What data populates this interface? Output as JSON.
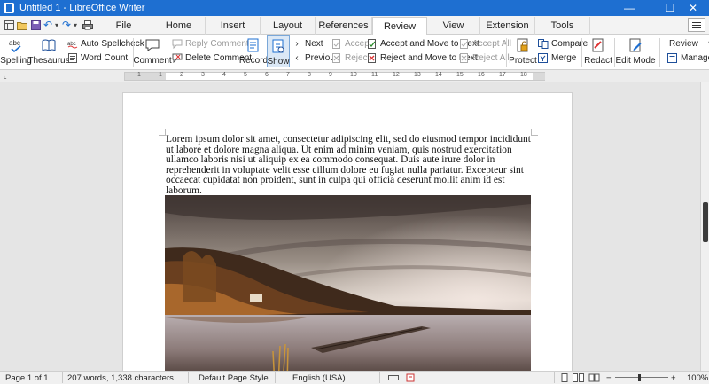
{
  "window": {
    "title": "Untitled 1 - LibreOffice Writer",
    "controls": {
      "minimize": "—",
      "maximize": "☐",
      "close": "✕"
    }
  },
  "quick_access": [
    {
      "icon": "menu-grid-icon"
    },
    {
      "icon": "open-folder-icon"
    },
    {
      "icon": "save-icon"
    },
    {
      "icon": "undo-icon",
      "glyph": "↶"
    },
    {
      "icon": "dropdown-icon",
      "glyph": "▾"
    },
    {
      "icon": "redo-icon",
      "glyph": "↷"
    },
    {
      "icon": "dropdown-icon",
      "glyph": "▾"
    },
    {
      "icon": "print-icon"
    }
  ],
  "tabs": [
    "File",
    "Home",
    "Insert",
    "Layout",
    "References",
    "Review",
    "View",
    "Extension",
    "Tools"
  ],
  "active_tab": "Review",
  "ribbon": {
    "spelling": "Spelling",
    "thesaurus": "Thesaurus",
    "auto_spellcheck": "Auto Spellcheck",
    "word_count": "Word Count",
    "comment": "Comment",
    "reply_comment": "Reply Comment",
    "delete_comment": "Delete Comment",
    "record": "Record",
    "show": "Show",
    "next": "Next",
    "previous": "Previous",
    "accept": "Accept",
    "reject": "Reject",
    "accept_and_move": "Accept and Move to Next",
    "reject_and_move": "Reject and Move to Next",
    "accept_all": "Accept All",
    "reject_all": "Reject All",
    "protect": "Protect",
    "compare": "Compare",
    "merge": "Merge",
    "redact": "Redact",
    "edit_mode": "Edit Mode",
    "review_dropdown": "Review",
    "manage": "Manage"
  },
  "ruler": {
    "labels": [
      "1",
      "1",
      "2",
      "3",
      "4",
      "5",
      "6",
      "7",
      "8",
      "9",
      "10",
      "11",
      "12",
      "13",
      "14",
      "15",
      "16",
      "17",
      "18"
    ]
  },
  "document": {
    "paragraph": "Lorem ipsum dolor sit amet, consectetur adipiscing elit, sed do eiusmod tempor incididunt ut labore et dolore magna aliqua. Ut enim ad minim veniam, quis nostrud exercitation ullamco laboris nisi ut aliquip ex ea commodo consequat. Duis aute irure dolor in reprehenderit in voluptate velit esse cillum dolore eu fugiat nulla pariatur. Excepteur sint occaecat cupidatat non proident, sunt in culpa qui officia deserunt mollit anim id est laborum."
  },
  "statusbar": {
    "page": "Page 1 of 1",
    "words": "207 words, 1,338 characters",
    "page_style": "Default Page Style",
    "language": "English (USA)",
    "zoom": "100%",
    "zoom_minus": "−",
    "zoom_plus": "+"
  },
  "colors": {
    "titlebar": "#1e6fd1",
    "active_button": "#dbe8f6"
  }
}
